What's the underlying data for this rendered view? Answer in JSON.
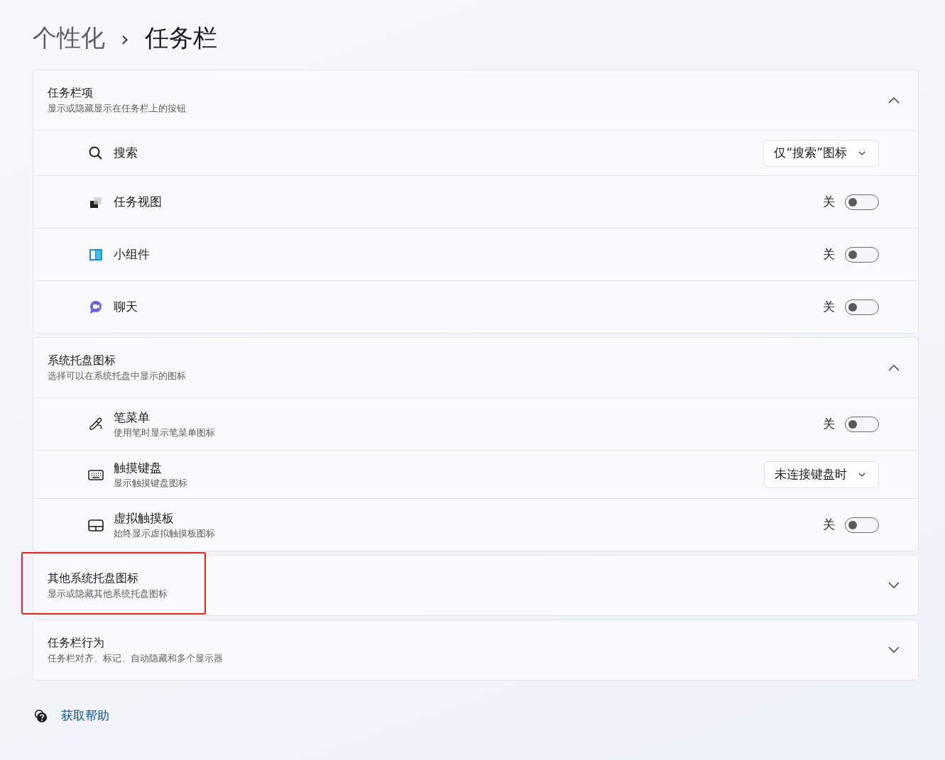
{
  "breadcrumb": {
    "parent": "个性化",
    "separator": "›",
    "current": "任务栏"
  },
  "sections": [
    {
      "title": "任务栏项",
      "subtitle": "显示或隐藏显示在任务栏上的按钮",
      "expanded": true,
      "highlighted": false,
      "rows": [
        {
          "kind": "dropdown",
          "label": "搜索",
          "value": "仅“搜索”图标"
        },
        {
          "kind": "toggle",
          "label": "任务视图",
          "state_text": "关",
          "on": false
        },
        {
          "kind": "toggle",
          "label": "小组件",
          "state_text": "关",
          "on": false
        },
        {
          "kind": "toggle",
          "label": "聊天",
          "state_text": "关",
          "on": false
        }
      ]
    },
    {
      "title": "系统托盘图标",
      "subtitle": "选择可以在系统托盘中显示的图标",
      "expanded": true,
      "highlighted": false,
      "rows": [
        {
          "kind": "toggle",
          "label": "笔菜单",
          "description": "使用笔时显示笔菜单图标",
          "state_text": "关",
          "on": false
        },
        {
          "kind": "dropdown",
          "label": "触摸键盘",
          "description": "显示触摸键盘图标",
          "value": "未连接键盘时"
        },
        {
          "kind": "toggle",
          "label": "虚拟触摸板",
          "description": "始终显示虚拟触摸板图标",
          "state_text": "关",
          "on": false
        }
      ]
    },
    {
      "title": "其他系统托盘图标",
      "subtitle": "显示或隐藏其他系统托盘图标",
      "expanded": false,
      "highlighted": true
    },
    {
      "title": "任务栏行为",
      "subtitle": "任务栏对齐、标记、自动隐藏和多个显示器",
      "expanded": false,
      "highlighted": false
    }
  ],
  "help_link": "获取帮助"
}
